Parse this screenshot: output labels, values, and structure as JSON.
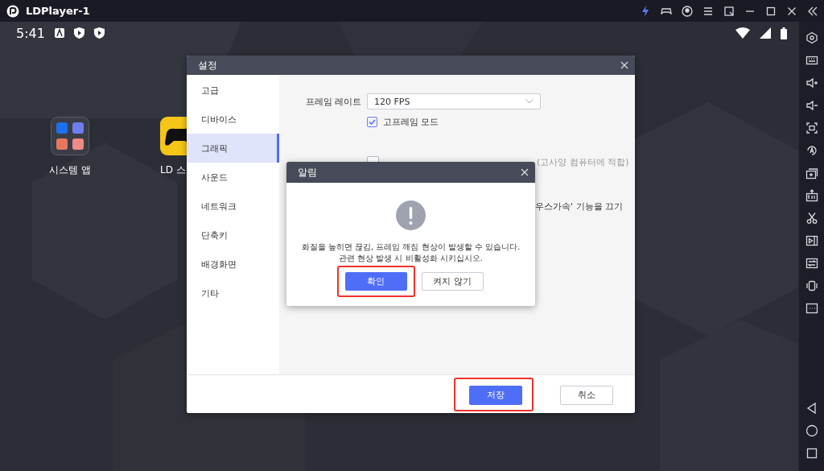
{
  "title_bar": {
    "title": "LDPlayer-1"
  },
  "status_bar": {
    "time": "5:41"
  },
  "desktop_icons": [
    {
      "label": "시스템 앱",
      "kind": "folder"
    },
    {
      "label": "LD 스",
      "kind": "app"
    }
  ],
  "settings": {
    "title": "설정",
    "nav": [
      {
        "label": "고급",
        "selected": false
      },
      {
        "label": "디바이스",
        "selected": false
      },
      {
        "label": "그래픽",
        "selected": true
      },
      {
        "label": "사운드",
        "selected": false
      },
      {
        "label": "네트워크",
        "selected": false
      },
      {
        "label": "단축키",
        "selected": false
      },
      {
        "label": "배경화면",
        "selected": false
      },
      {
        "label": "기타",
        "selected": false
      }
    ],
    "frame_rate": {
      "label": "프레임 레이트",
      "value": "120 FPS"
    },
    "high_frame": {
      "label": "고프레임 모드",
      "checked": true
    },
    "vsync": {
      "checked": false,
      "note": "(고사양 컴퓨터에 적합)"
    },
    "mouse_fragment": "우스가속' 기능을 끄기",
    "buttons": [
      {
        "label": "저장",
        "kind": "primary",
        "highlighted": true
      },
      {
        "label": "취소",
        "kind": "secondary",
        "highlighted": false
      }
    ]
  },
  "alert": {
    "title": "알림",
    "message": [
      "화질을 높히면 끊김, 프레임 깨짐 현상이 발생할 수 있습니다.",
      "관련 현상 발생 시 비활성화 시키십시오."
    ],
    "buttons": [
      {
        "label": "확인",
        "kind": "primary",
        "highlighted": true
      },
      {
        "label": "켜지 않기",
        "kind": "secondary",
        "highlighted": false
      }
    ]
  }
}
